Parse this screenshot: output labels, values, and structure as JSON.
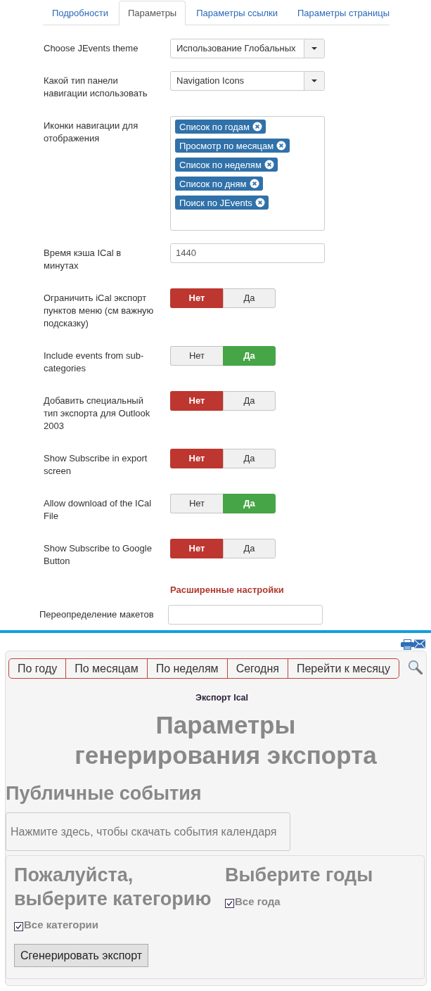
{
  "tabs": [
    {
      "label": "Подробности",
      "selected": false
    },
    {
      "label": "Параметры",
      "selected": true
    },
    {
      "label": "Параметры ссылки",
      "selected": false
    },
    {
      "label": "Параметры страницы",
      "selected": false
    }
  ],
  "fields": [
    {
      "kind": "select",
      "label": "Choose JEvents theme",
      "value": "Использование Глобальных"
    },
    {
      "kind": "select",
      "label": "Какой тип панели навигации использовать",
      "value": "Navigation Icons"
    },
    {
      "kind": "tags",
      "label": "Иконки навигации для отображения",
      "tags": [
        "Список по годам",
        "Просмотр по месяцам",
        "Список по неделям",
        "Список по дням",
        "Поиск по JEvents"
      ]
    },
    {
      "kind": "text",
      "label": "Время кэша ICal в минутах",
      "value": "1440"
    },
    {
      "kind": "toggle",
      "label": "Ограничить iCal экспорт пунктов меню (см важную подсказку)",
      "options": [
        {
          "label": "Нет",
          "selected": true
        },
        {
          "label": "Да",
          "selected": false
        }
      ]
    },
    {
      "kind": "toggle",
      "label": "Include events from sub-categories",
      "options": [
        {
          "label": "Нет",
          "selected": false
        },
        {
          "label": "Да",
          "selected": true
        }
      ]
    },
    {
      "kind": "toggle",
      "label": "Добавить специальный тип экспорта для Outlook 2003",
      "options": [
        {
          "label": "Нет",
          "selected": true
        },
        {
          "label": "Да",
          "selected": false
        }
      ]
    },
    {
      "kind": "toggle",
      "label": "Show Subscribe in export screen",
      "options": [
        {
          "label": "Нет",
          "selected": true
        },
        {
          "label": "Да",
          "selected": false
        }
      ]
    },
    {
      "kind": "toggle",
      "label": "Allow download of the ICal File",
      "options": [
        {
          "label": "Нет",
          "selected": false
        },
        {
          "label": "Да",
          "selected": true
        }
      ]
    },
    {
      "kind": "toggle",
      "label": "Show Subscribe to Google Button",
      "options": [
        {
          "label": "Нет",
          "selected": true
        },
        {
          "label": "Да",
          "selected": false
        }
      ]
    }
  ],
  "advanced": {
    "heading": "Расширенные настройки",
    "fields": [
      {
        "kind": "text",
        "label": "Переопределение макетов"
      }
    ]
  },
  "calendar": {
    "nav": [
      "По году",
      "По месяцам",
      "По неделям",
      "Сегодня",
      "Перейти к месяцу"
    ],
    "subtitle": "Экспорт Ical",
    "title": "Параметры генерирования экспорта",
    "section_title": "Публичные события",
    "download_link": "Нажмите здесь, чтобы скачать события календаря",
    "categories": {
      "heading": "Пожалуйста, выберите категорию",
      "checkbox": {
        "label": "Все категории",
        "checked": true
      }
    },
    "years": {
      "heading": "Выберите годы",
      "checkbox": {
        "label": "Все года",
        "checked": true
      }
    },
    "button": "Сгенерировать экспорт"
  }
}
